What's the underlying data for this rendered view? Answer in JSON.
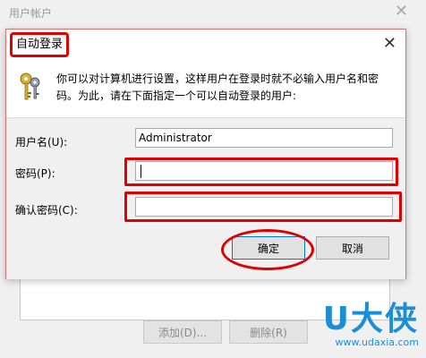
{
  "background_window": {
    "title": "用户帐户",
    "close_glyph": "✕",
    "buttons": {
      "add": "添加(D)...",
      "remove": "删除(R)"
    }
  },
  "dialog": {
    "title": "自动登录",
    "close_glyph": "✕",
    "description": "你可以对计算机进行设置，这样用户在登录时就不必输入用户名和密码。为此，请在下面指定一个可以自动登录的用户:",
    "icon": "keys-icon",
    "fields": {
      "username": {
        "label": "用户名(U):",
        "value": "Administrator"
      },
      "password": {
        "label": "密码(P):",
        "value": ""
      },
      "confirm": {
        "label": "确认密码(C):",
        "value": ""
      }
    },
    "buttons": {
      "ok": "确定",
      "cancel": "取消"
    }
  },
  "highlight_color": "#e00000",
  "watermark": {
    "logo": "U大侠",
    "url": "www.udaxia.com"
  }
}
